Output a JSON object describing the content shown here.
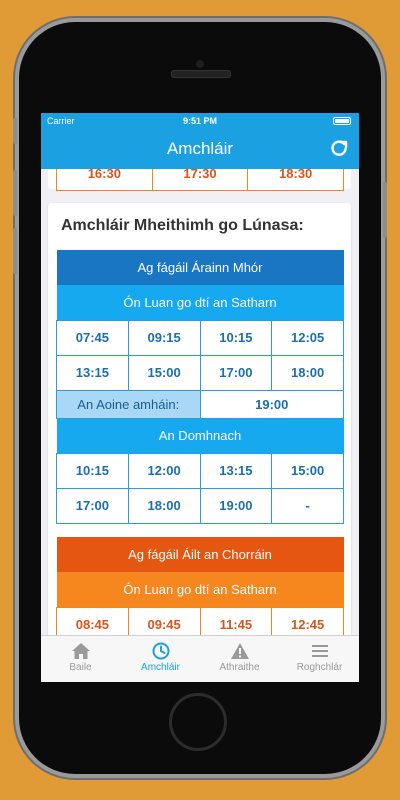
{
  "status_bar": {
    "carrier": "Carrier",
    "time": "9:51 PM"
  },
  "nav": {
    "title": "Amchláir",
    "refresh_icon": "refresh-icon"
  },
  "previous_row": [
    "16:30",
    "17:30",
    "18:30"
  ],
  "section": {
    "title": "Amchláir Mheithimh go Lúnasa:",
    "aran": {
      "header": "Ag fágáil Árainn Mhór",
      "weekdays_label": "Ón Luan go dtí an Satharn",
      "weekday_times": [
        [
          "07:45",
          "09:15",
          "10:15",
          "12:05"
        ],
        [
          "13:15",
          "15:00",
          "17:00",
          "18:00"
        ]
      ],
      "friday_label": "An Aoine amháin:",
      "friday_time": "19:00",
      "sunday_label": "An Domhnach",
      "sunday_times": [
        [
          "10:15",
          "12:00",
          "13:15",
          "15:00"
        ],
        [
          "17:00",
          "18:00",
          "19:00",
          "-"
        ]
      ]
    },
    "burtonport": {
      "header": "Ag fágáil Áilt an Chorráin",
      "weekdays_label": "Ón Luan go dtí an Satharn",
      "weekday_times": [
        [
          "08:45",
          "09:45",
          "11:45",
          "12:45"
        ]
      ]
    }
  },
  "tabs": [
    {
      "label": "Baile",
      "icon": "home-icon"
    },
    {
      "label": "Amchláir",
      "icon": "clock-icon",
      "active": true
    },
    {
      "label": "Athraithe",
      "icon": "warning-icon"
    },
    {
      "label": "Roghchlár",
      "icon": "menu-icon"
    }
  ],
  "colors": {
    "accent": "#1ba1e2",
    "blue_dark": "#1976c2",
    "orange_dark": "#e55611",
    "orange": "#f6861e",
    "background": "#E09A36"
  }
}
